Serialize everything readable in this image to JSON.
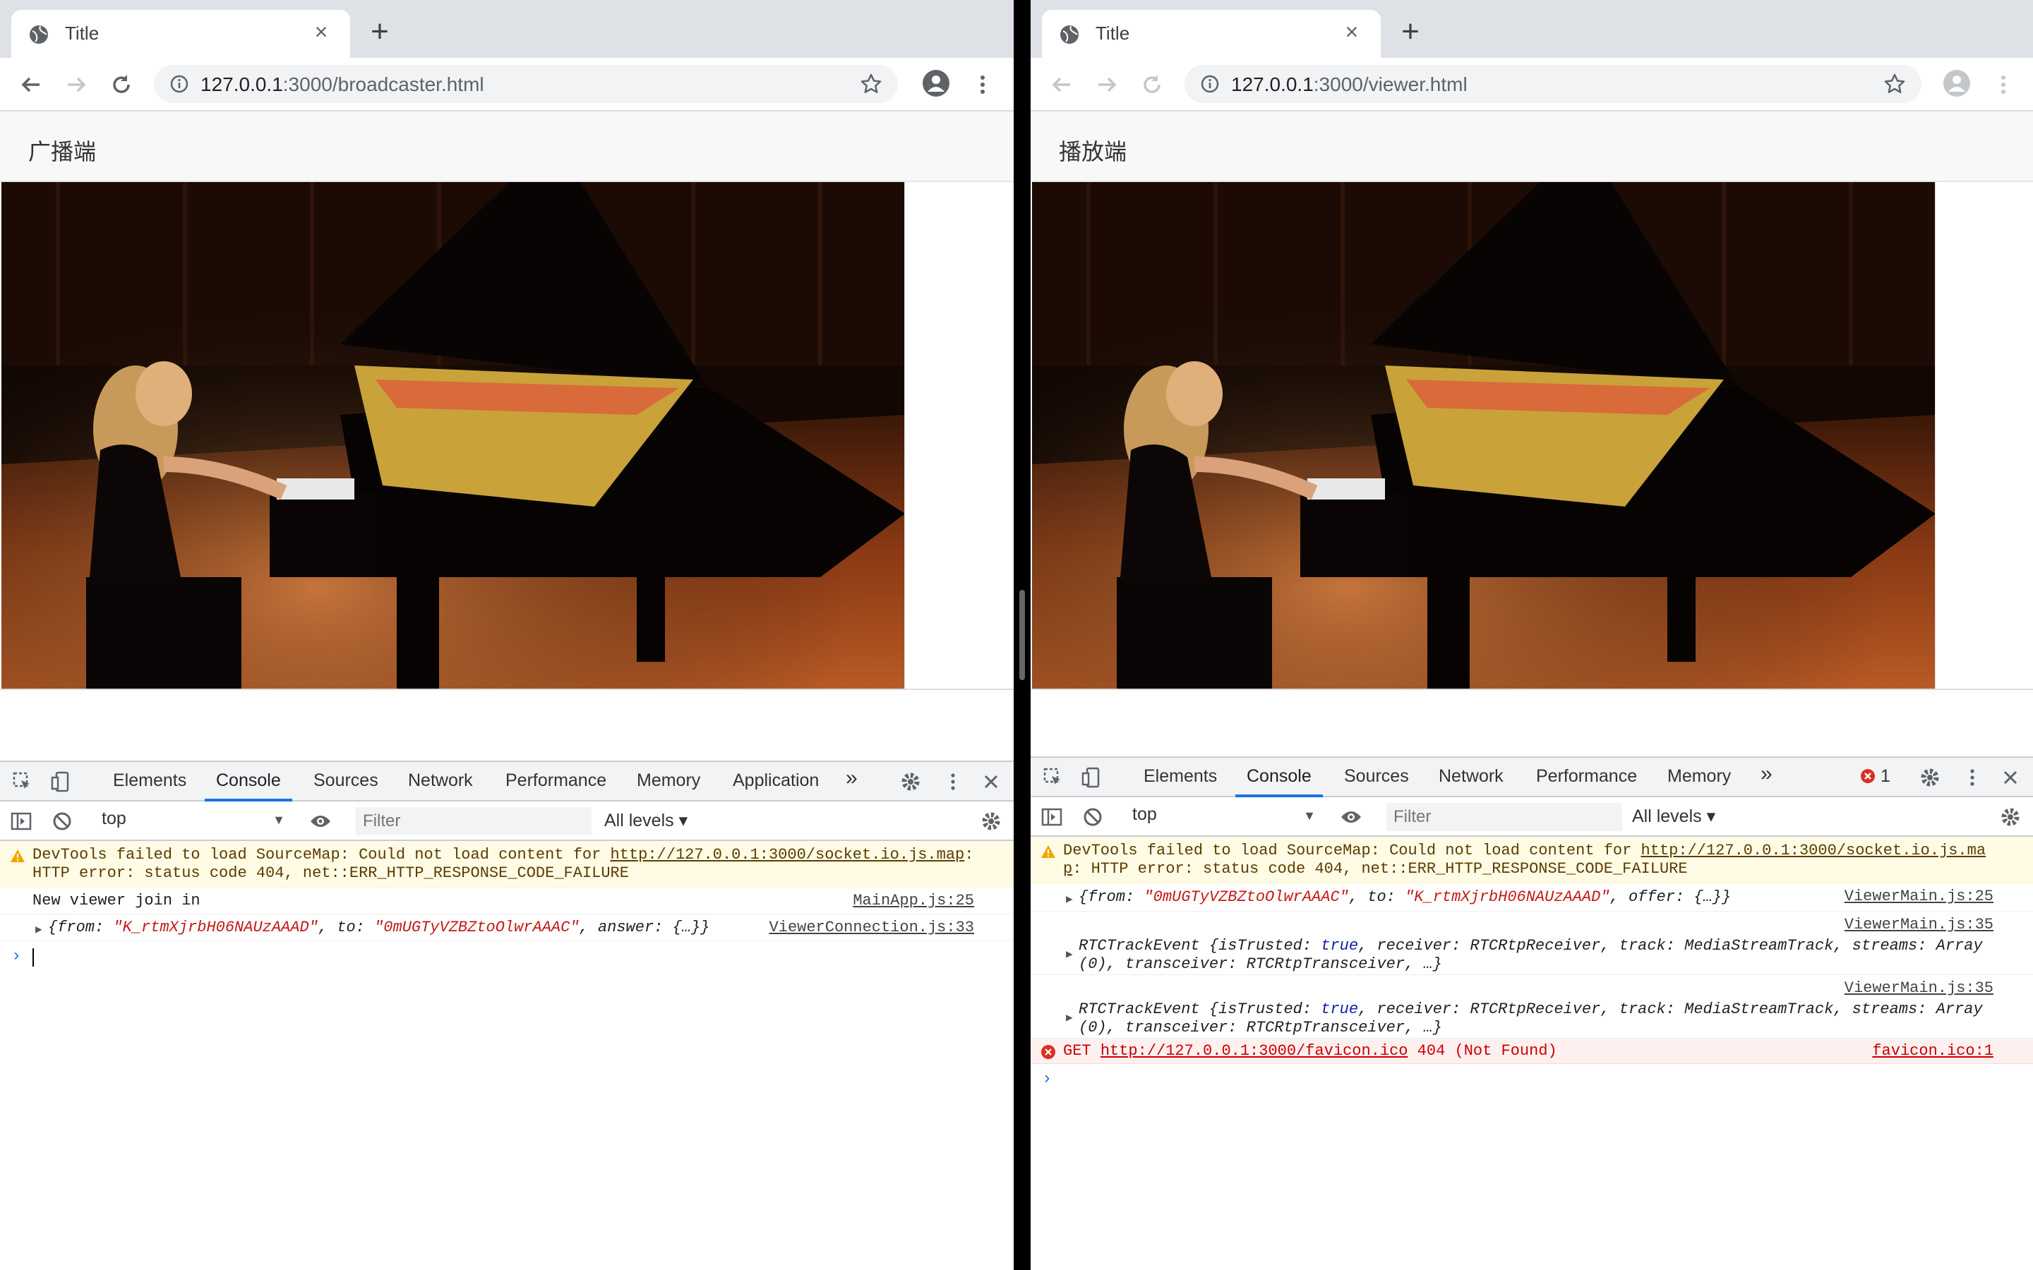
{
  "left": {
    "tab_title": "Title",
    "url_host": "127.0.0.1",
    "url_rest": ":3000/broadcaster.html",
    "page_heading": "广播端",
    "devtools": {
      "tabs": [
        "Elements",
        "Console",
        "Sources",
        "Network",
        "Performance",
        "Memory",
        "Application"
      ],
      "context": "top",
      "filter_placeholder": "Filter",
      "levels": "All levels",
      "messages": {
        "warn_prefix": "DevTools failed to load SourceMap: Could not load content for ",
        "warn_link": "http://127.0.0.1:3000/socket.io.js.map",
        "warn_suffix": ":",
        "warn_line2": "HTTP error: status code 404, net::ERR_HTTP_RESPONSE_CODE_FAILURE",
        "log1": "New viewer join in",
        "log1_src": "MainApp.js:25",
        "obj_open": "{from: ",
        "obj_from": "\"K_rtmXjrbH06NAUzAAAD\"",
        "obj_to_key": ", to: ",
        "obj_to": "\"0mUGTyVZBZtoOlwrAAAC\"",
        "obj_rest": ", answer: {…}}",
        "log2_src": "ViewerConnection.js:33"
      }
    }
  },
  "right": {
    "tab_title": "Title",
    "url_host": "127.0.0.1",
    "url_rest": ":3000/viewer.html",
    "page_heading": "播放端",
    "devtools": {
      "tabs": [
        "Elements",
        "Console",
        "Sources",
        "Network",
        "Performance",
        "Memory"
      ],
      "error_count": "1",
      "context": "top",
      "filter_placeholder": "Filter",
      "levels": "All levels",
      "messages": {
        "warn_prefix": "DevTools failed to load SourceMap: Could not load content for ",
        "warn_link1": "http://127.0.0.1:3000/socket.io.js.ma",
        "warn_link2": "p",
        "warn_line2": ": HTTP error: status code 404, net::ERR_HTTP_RESPONSE_CODE_FAILURE",
        "obj_open": "{from: ",
        "obj_from": "\"0mUGTyVZBZtoOlwrAAAC\"",
        "obj_to_key": ", to: ",
        "obj_to": "\"K_rtmXjrbH06NAUzAAAD\"",
        "obj_rest": ", offer: {…}}",
        "log1_src": "ViewerMain.js:25",
        "track_src": "ViewerMain.js:35",
        "track_a": "RTCTrackEvent {isTrusted: ",
        "track_true": "true",
        "track_b": ", receiver: RTCRtpReceiver, track: MediaStreamTrack, streams: Array",
        "track_line2": "(0), transceiver: RTCRtpTransceiver, …}",
        "err_get": "GET ",
        "err_link": "http://127.0.0.1:3000/favicon.ico",
        "err_rest": " 404 (Not Found)",
        "err_src": "favicon.ico:1"
      }
    }
  }
}
